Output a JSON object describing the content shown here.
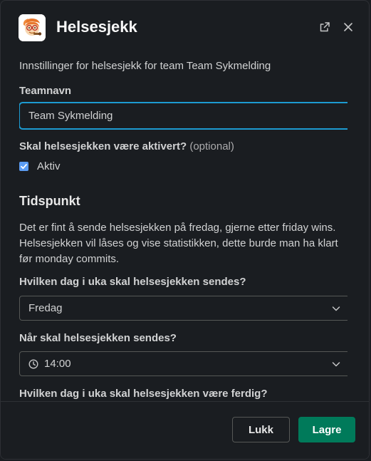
{
  "header": {
    "title": "Helsesjekk"
  },
  "main": {
    "intro_text": "Innstillinger for helsesjekk for team Team Sykmelding",
    "team_name": {
      "label": "Teamnavn",
      "value": "Team Sykmelding"
    },
    "active": {
      "label": "Skal helsesjekken være aktivert?",
      "optional_text": "(optional)",
      "checkbox_label": "Aktiv",
      "checked": true
    },
    "section_title": "Tidspunkt",
    "section_description": "Det er fint å sende helsesjekken på fredag, gjerne etter friday wins. Helsesjekken vil låses og vise statistikken, dette burde man ha klart før monday commits.",
    "send_day": {
      "label": "Hvilken dag i uka skal helsesjekken sendes?",
      "selected": "Fredag"
    },
    "send_time": {
      "label": "Når skal helsesjekken sendes?",
      "selected": "14:00"
    },
    "finish_day": {
      "label": "Hvilken dag i uka skal helsesjekken være ferdig?"
    }
  },
  "footer": {
    "cancel_label": "Lukk",
    "save_label": "Lagre"
  },
  "colors": {
    "background": "#1a1d21",
    "focus_border": "#1d9bd1",
    "checkbox": "#5b9cf2",
    "primary_button": "#007a5a"
  },
  "icons": {
    "app_icon": "app-avatar-icon",
    "open_external": "external-link-icon",
    "close": "close-icon",
    "dropdown": "chevron-down-icon",
    "clock": "clock-icon"
  }
}
